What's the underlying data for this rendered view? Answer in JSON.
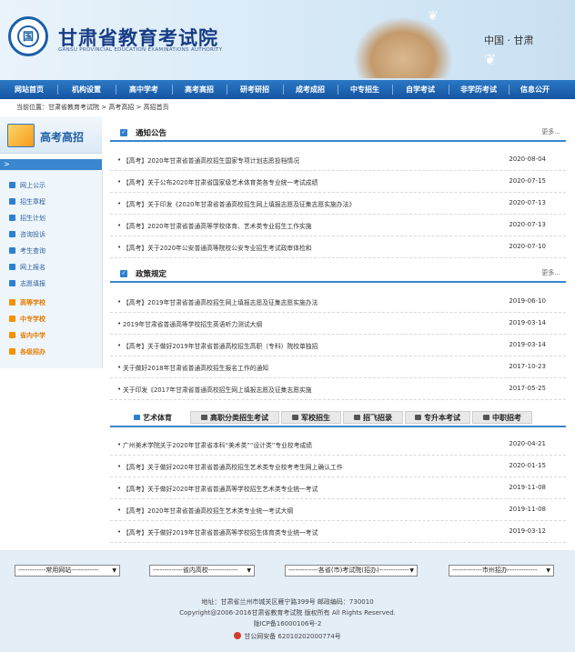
{
  "header": {
    "title": "甘肃省教育考试院",
    "subtitle": "GANSU PROVINCIAL EDUCATION EXAMINATIONS AUTHORITY",
    "region": "中国 · 甘肃",
    "logo_glyph": "国"
  },
  "nav": [
    "网站首页",
    "机构设置",
    "高中学考",
    "高考高招",
    "研考研招",
    "成考成招",
    "中专招生",
    "自学考试",
    "非学历考试",
    "信息公开"
  ],
  "breadcrumb": "当前位置：甘肃省教育考试院 > 高考高招 > 高招首页",
  "sidebar": {
    "title": "高考高招",
    "strip": ">",
    "items": [
      "网上公示",
      "招生章程",
      "招生计划",
      "咨询投诉",
      "考生查询",
      "网上报名",
      "志愿填报"
    ],
    "highlight_items": [
      "高等学校",
      "中专学校",
      "省内中学",
      "各级招办"
    ]
  },
  "sections": [
    {
      "title": "通知公告",
      "more": "更多...",
      "rows": [
        {
          "bullet": "•",
          "title": "【高考】2020年甘肃省普通高校招生国家专项计划志愿投档情况",
          "date": "2020-08-04"
        },
        {
          "bullet": "•",
          "title": "【高考】关于公布2020年甘肃省国家级艺术体育类各专业统一考试成绩",
          "date": "2020-07-15"
        },
        {
          "bullet": "•",
          "title": "【高考】关于印发《2020年甘肃省普通高校招生网上填报志愿及征集志愿实施办法》",
          "date": "2020-07-13"
        },
        {
          "bullet": "•",
          "title": "【高考】2020年甘肃省普通高等学校体育、艺术类专业招生工作实施",
          "date": "2020-07-13"
        },
        {
          "bullet": "•",
          "title": "【高考】关于2020年公安普通高等院校公安专业招生考试政审体检和",
          "date": "2020-07-10"
        }
      ]
    },
    {
      "title": "政策规定",
      "more": "更多...",
      "rows": [
        {
          "bullet": "•",
          "title": "【高考】2019年甘肃省普通高校招生网上填报志愿及征集志愿实施办法",
          "date": "2019-06-10"
        },
        {
          "bullet": "•",
          "title": "2019年甘肃省普通高等学校招生英语听力测试大纲",
          "date": "2019-03-14"
        },
        {
          "bullet": "•",
          "title": "【高考】关于做好2019年甘肃省普通高校招生高职（专科）院校单独招",
          "date": "2019-03-14"
        },
        {
          "bullet": "•",
          "title": "关于做好2018年甘肃省普通高校招生报名工作的通知",
          "date": "2017-10-23"
        },
        {
          "bullet": "•",
          "title": "关于印发《2017年甘肃省普通高校招生网上填报志愿及征集志愿实施",
          "date": "2017-05-25"
        }
      ]
    }
  ],
  "tabs": [
    "艺术体育",
    "高职分类招生考试",
    "军校招生",
    "招飞招录",
    "专升本考试",
    "中职招考"
  ],
  "tab_rows": [
    {
      "bullet": "•",
      "title": "广州美术学院关于2020年甘肃省本科“美术类”“设计类”专业校考成绩",
      "date": "2020-04-21"
    },
    {
      "bullet": "•",
      "title": "【高考】关于做好2020年甘肃省普通高校招生艺术类专业校考考生网上确认工作",
      "date": "2020-01-15"
    },
    {
      "bullet": "•",
      "title": "【高考】关于做好2020年甘肃省普通高等学校招生艺术类专业统一考试",
      "date": "2019-11-08"
    },
    {
      "bullet": "•",
      "title": "【高考】2020年甘肃省普通高校招生艺术类专业统一考试大纲",
      "date": "2019-11-08"
    },
    {
      "bullet": "•",
      "title": "【高考】关于做好2019年甘肃省普通高等学校招生体育类专业统一考试",
      "date": "2019-03-12"
    }
  ],
  "footer": {
    "selects": [
      "------------常用网站------------",
      "-------------省内高校-------------",
      "-------------各省(市)考试院(招办)-------------",
      "-------------市州招办-------------"
    ],
    "address": "地址：甘肃省兰州市城关区雁宁路399号   邮政编码：730010",
    "copyright": "Copyright@2006-2016甘肃省教育考试院   版权所有 All Rights Reserved.",
    "icp": "陇ICP备16000106号-2",
    "police": "甘公网安备 62010202000774号"
  }
}
